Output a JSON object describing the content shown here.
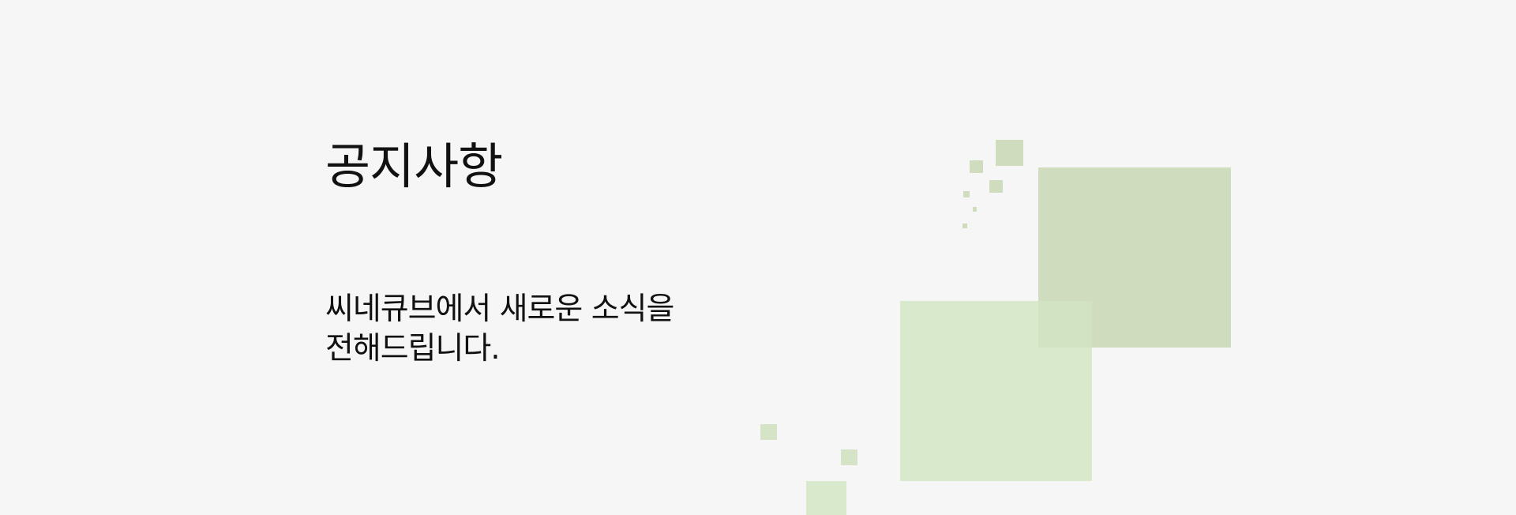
{
  "notice": {
    "title": "공지사항",
    "description_line1": "씨네큐브에서 새로운 소식을",
    "description_line2": "전해드립니다."
  },
  "colors": {
    "background": "#f6f6f6",
    "text": "#111111",
    "square_dark": "#cfddbe",
    "square_light": "#d9e9cb"
  }
}
